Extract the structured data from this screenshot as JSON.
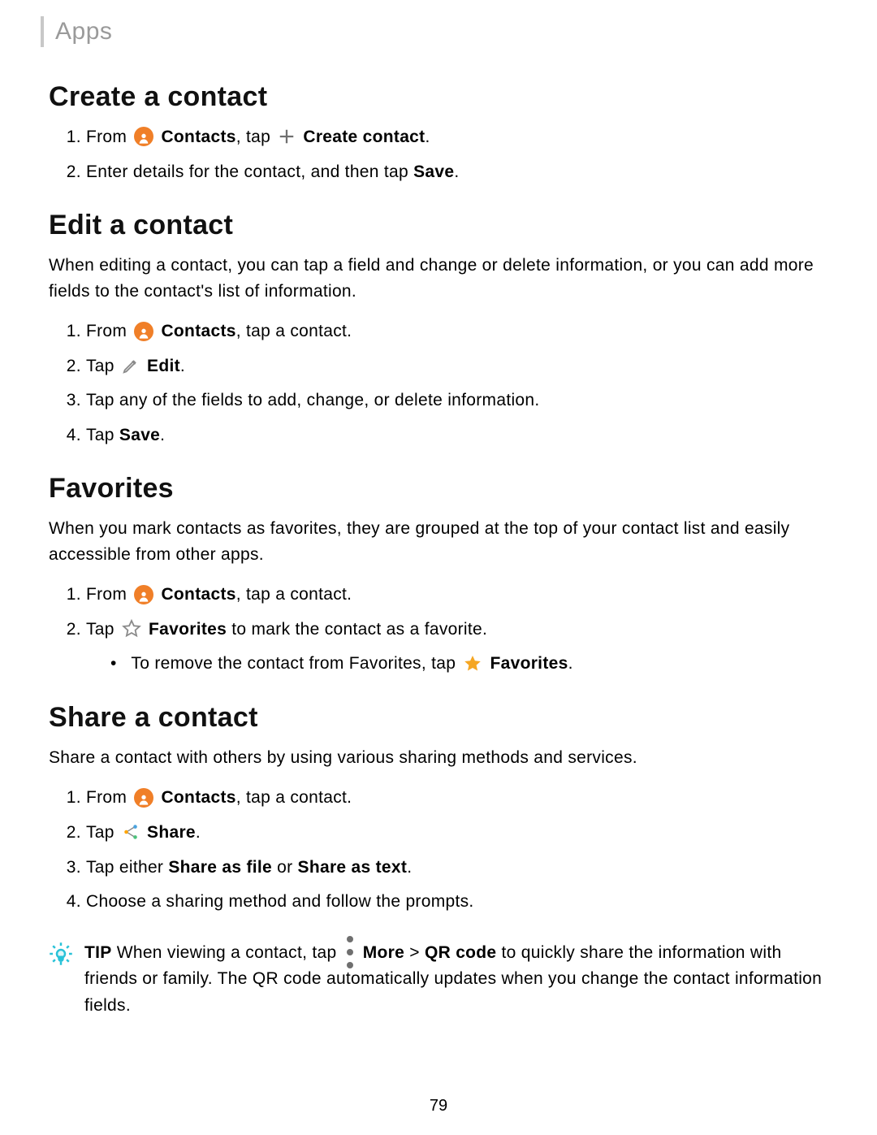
{
  "header": "Apps",
  "footer_page": "79",
  "sections": {
    "create": {
      "title": "Create a contact",
      "steps": [
        {
          "from": "From ",
          "contacts_b": "Contacts",
          "mid": ", tap ",
          "create_b": "Create contact",
          "end": "."
        },
        {
          "pre": "Enter details for the contact, and then tap ",
          "save_b": "Save",
          "end": "."
        }
      ]
    },
    "edit": {
      "title": "Edit a contact",
      "desc": "When editing a contact, you can tap a field and change or delete information, or you can add more fields to the contact's list of information.",
      "steps": [
        {
          "from": "From ",
          "contacts_b": "Contacts",
          "end": ", tap a contact."
        },
        {
          "pre": "Tap ",
          "edit_b": "Edit",
          "end": "."
        },
        {
          "text": "Tap any of the fields to add, change, or delete information."
        },
        {
          "pre": "Tap ",
          "save_b": "Save",
          "end": "."
        }
      ]
    },
    "fav": {
      "title": "Favorites",
      "desc": "When you mark contacts as favorites, they are grouped at the top of your contact list and easily accessible from other apps.",
      "steps": [
        {
          "from": "From ",
          "contacts_b": "Contacts",
          "end": ", tap a contact."
        },
        {
          "pre": "Tap ",
          "fav_b": "Favorites",
          "end": " to mark the contact as a favorite.",
          "sub": {
            "pre": "To remove the contact from Favorites, tap ",
            "fav_b": "Favorites",
            "end": "."
          }
        }
      ]
    },
    "share": {
      "title": "Share a contact",
      "desc": "Share a contact with others by using various sharing methods and services.",
      "steps": [
        {
          "from": "From ",
          "contacts_b": "Contacts",
          "end": ", tap a contact."
        },
        {
          "pre": "Tap ",
          "share_b": "Share",
          "end": "."
        },
        {
          "pre": "Tap either ",
          "file_b": "Share as file",
          "mid": " or ",
          "text_b": "Share as text",
          "end": "."
        },
        {
          "text": "Choose a sharing method and follow the prompts."
        }
      ],
      "tip": {
        "label": "TIP",
        "pre": " When viewing a contact, tap ",
        "more_b": "More",
        "gt": " > ",
        "qr_b": "QR code",
        "rest": " to quickly share the information with friends or family. The QR code automatically updates when you change the contact information fields."
      }
    }
  }
}
